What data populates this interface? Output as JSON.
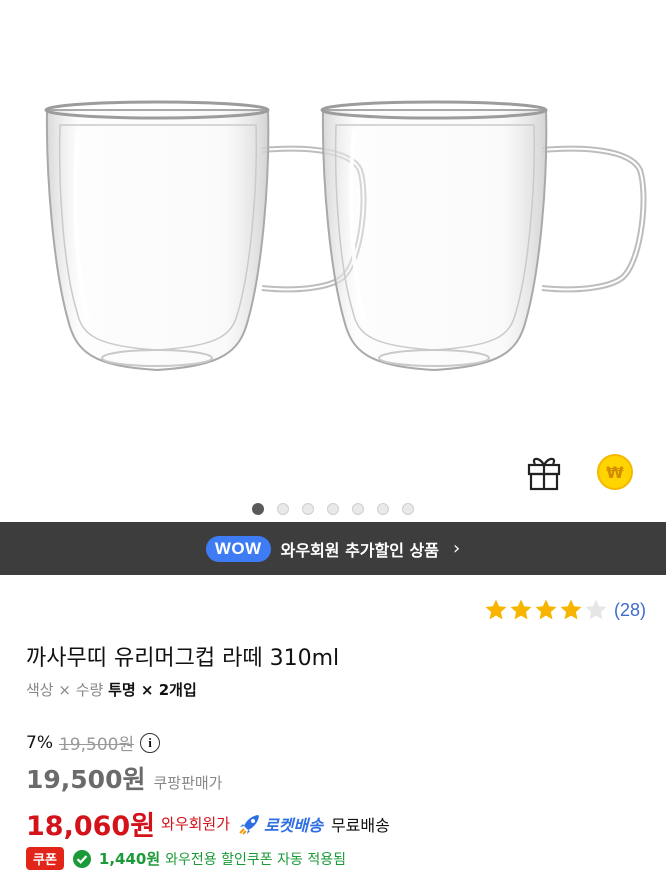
{
  "hero": {
    "image_alt": "두 개의 이중벽 유리 머그컵",
    "slide_count": 7,
    "active_slide": 0
  },
  "icons": {
    "gift": "gift-icon",
    "won": "won-coin-icon"
  },
  "wow_banner": {
    "badge": "WOW",
    "text": "와우회원 추가할인 상품",
    "chevron": "›"
  },
  "rating": {
    "stars": 4,
    "max": 5,
    "review_count": "(28)"
  },
  "product": {
    "title": "까사무띠 유리머그컵 라떼 310ml",
    "option_label": "색상 × 수량",
    "option_value": "투명 × 2개입"
  },
  "pricing": {
    "discount_rate": "7%",
    "original_price": "19,500원",
    "info_icon": "i",
    "coupang_price": "19,500원",
    "coupang_price_label": "쿠팡판매가",
    "wow_price": "18,060원",
    "wow_price_label": "와우회원가",
    "rocket_label": "로켓배송",
    "shipping": "무료배송"
  },
  "coupon": {
    "badge": "쿠폰",
    "amount": "1,440원",
    "text": "와우전용 할인쿠폰 자동 적용됨"
  },
  "colors": {
    "wow_blue": "#3e7cf5",
    "price_red": "#d3121a",
    "coupon_green": "#1c9a39",
    "star_gold": "#f7b500",
    "banner_bg": "#3d3d3d"
  }
}
